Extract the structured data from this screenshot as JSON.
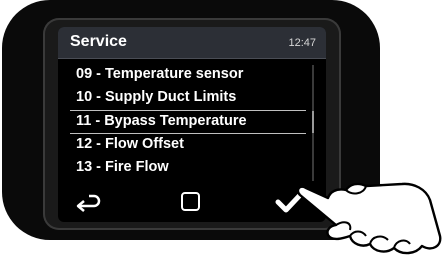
{
  "header": {
    "title": "Service",
    "time": "12:47"
  },
  "menu": {
    "items": [
      {
        "number": "09 -",
        "label": "Temperature sensor"
      },
      {
        "number": "10 -",
        "label": "Supply Duct Limits"
      },
      {
        "number": "11 -",
        "label": "Bypass Temperature"
      },
      {
        "number": "12 -",
        "label": "Flow Offset"
      },
      {
        "number": "13 -",
        "label": "Fire Flow"
      }
    ],
    "selected_index": 2
  },
  "footer": {
    "back_icon": "back-arrow-icon",
    "home_icon": "square-icon",
    "confirm_icon": "checkmark-icon"
  },
  "colors": {
    "screen_bg": "#000000",
    "header_bg": "#2c2f36",
    "text": "#ffffff",
    "device_body": "#0a0a0a"
  }
}
